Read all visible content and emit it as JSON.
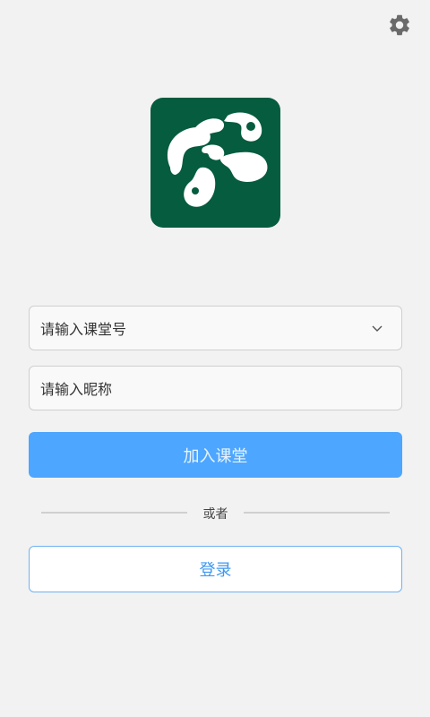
{
  "icons": {
    "settings": "gear-icon",
    "logo": "app-logo",
    "dropdown": "chevron-down-icon"
  },
  "form": {
    "classroom_placeholder": "请输入课堂号",
    "nickname_placeholder": "请输入昵称",
    "join_label": "加入课堂",
    "or_label": "或者",
    "login_label": "登录"
  },
  "colors": {
    "background": "#f2f2f2",
    "logo_bg": "#055c3e",
    "primary": "#4da6ff",
    "login_text": "#3d98f0"
  }
}
